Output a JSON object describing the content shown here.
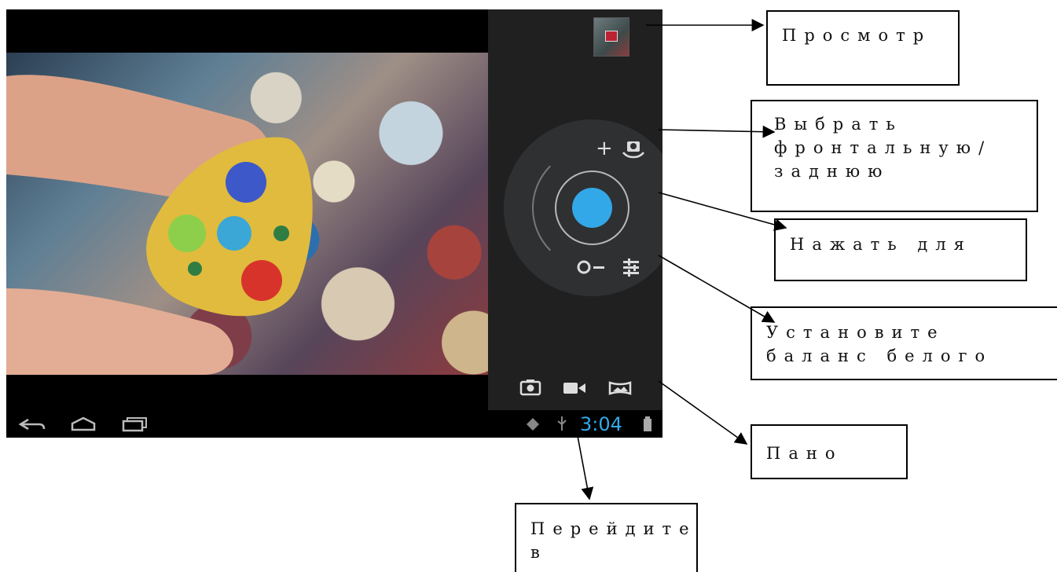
{
  "camera": {
    "zoom_in_icon": "+",
    "zoom_out_icon": "−",
    "switch_camera_icon": "camera-switch",
    "settings_icon": "sliders",
    "modes": [
      "photo",
      "video",
      "panorama"
    ],
    "accent_color": "#33a8e8"
  },
  "status_bar": {
    "time": "3:04"
  },
  "callouts": {
    "preview": "Просмотр",
    "switch_camera": "Выбрать фронтальную/заднюю",
    "press_to": "Нажать для",
    "white_balance": "Установите баланс белого",
    "panorama": "Пано",
    "go_to": "Перейдите в"
  }
}
